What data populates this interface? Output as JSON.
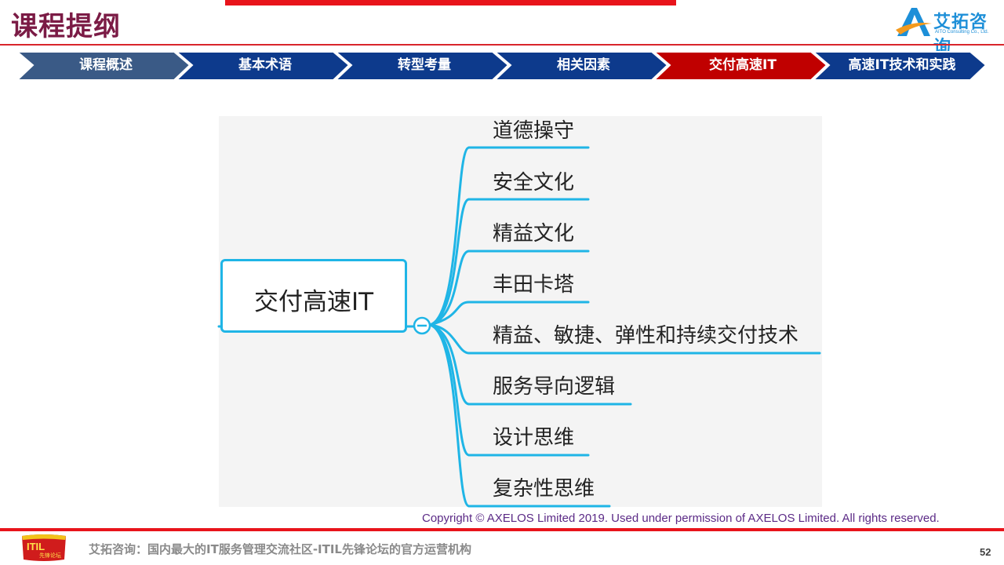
{
  "header": {
    "title": "课程提纲",
    "logo": {
      "name": "艾拓咨询",
      "sub": "AITO Consulting Co., Ltd."
    }
  },
  "nav": {
    "steps": [
      {
        "label": "课程概述",
        "state": "done"
      },
      {
        "label": "基本术语",
        "state": "default"
      },
      {
        "label": "转型考量",
        "state": "default"
      },
      {
        "label": "相关因素",
        "state": "default"
      },
      {
        "label": "交付高速IT",
        "state": "active"
      },
      {
        "label": "高速IT技术和实践",
        "state": "default"
      }
    ],
    "colors": {
      "done": "#3a5a86",
      "default": "#0d3a8c",
      "active": "#c00000"
    }
  },
  "mindmap": {
    "root": "交付高速IT",
    "collapse_icon": "minus-icon",
    "branches": [
      "道德操守",
      "安全文化",
      "精益文化",
      "丰田卡塔",
      "精益、敏捷、弹性和持续交付技术",
      "服务导向逻辑",
      "设计思维",
      "复杂性思维"
    ],
    "line_color": "#1fb5e6"
  },
  "footer": {
    "copyright": "Copyright © AXELOS Limited 2019. Used under permission of AXELOS Limited. All rights reserved.",
    "org_text": "艾拓咨询：国内最大的IT服务管理交流社区-ITIL先锋论坛的官方运营机构",
    "badge_text": "ITIL",
    "badge_subtext": "先锋论坛",
    "page_number": "52"
  }
}
